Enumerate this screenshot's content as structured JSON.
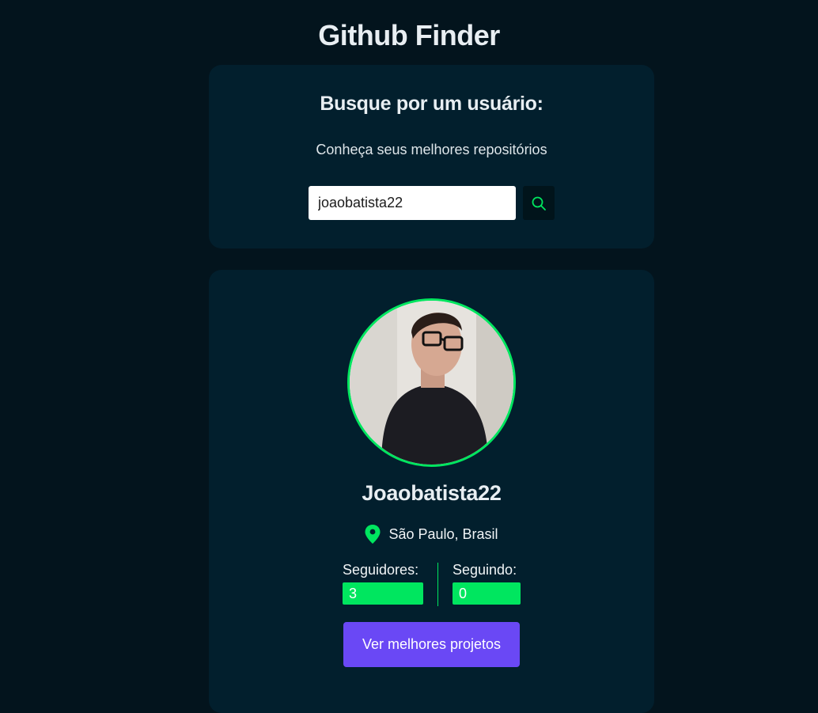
{
  "header": {
    "title": "Github Finder"
  },
  "search": {
    "heading": "Busque por um usuário:",
    "subtitle": "Conheça seus melhores repositórios",
    "value": "joaobatista22",
    "button_icon": "search-icon"
  },
  "profile": {
    "avatar_icon": "avatar",
    "username": "Joaobatista22",
    "location_icon": "location-pin-icon",
    "location": "São Paulo, Brasil",
    "followers_label": "Seguidores:",
    "followers_value": "3",
    "following_label": "Seguindo:",
    "following_value": "0",
    "cta_label": "Ver melhores projetos"
  },
  "colors": {
    "background": "#03141d",
    "card": "#021f2d",
    "accent_green": "#00e65f",
    "button_purple": "#6a48f5"
  }
}
